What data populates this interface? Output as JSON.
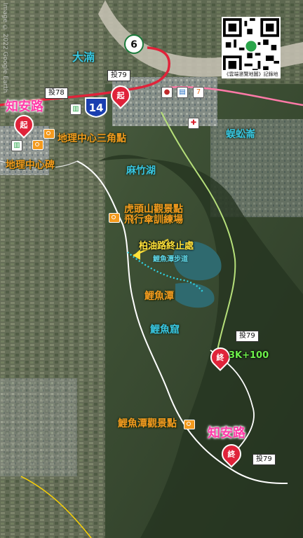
{
  "watermark": "Image © 2022 Google Earth",
  "qr_caption": "《雲端瀏覽地圖》記錄地",
  "labels": {
    "datan": "大湳",
    "zhian_road_top": "知安路",
    "zhian_road_bottom": "知安路",
    "geo_center_triangle": "地理中心三角點",
    "geo_center_monument": "地理中心碑",
    "mazhu_lake": "麻竹湖",
    "hutoushan_viewpoint": "虎頭山觀景點",
    "paragliding_field": "飛行傘訓練場",
    "paved_road_end": "柏油路終止處",
    "carp_trail": "鯉魚潭步道",
    "carp_lake": "鯉魚潭",
    "carp_cave": "鯉魚窟",
    "carp_lake_viewpoint": "鯉魚潭觀景點",
    "tortoise_pond": "蜈蚣崙",
    "distance": "3K+100"
  },
  "signs": {
    "tou79_top": "投79",
    "tou78": "投78",
    "tou79_right": "投79",
    "tou79_bottom": "投79"
  },
  "shields": {
    "route6": "6",
    "route14": "14"
  },
  "pins": {
    "start_top": "起",
    "start_left": "起",
    "end_mid": "終",
    "end_bottom": "終"
  },
  "colors": {
    "highway": "#e0233a",
    "trail_green": "#b6e07a",
    "route_white": "#ffffff",
    "river": "#c9c4b6",
    "lake": "#2f6a6f",
    "dotted_trail": "#2fd6e8",
    "highlight_pink": "#ff3aa8",
    "orange_label": "#f39a1e"
  }
}
